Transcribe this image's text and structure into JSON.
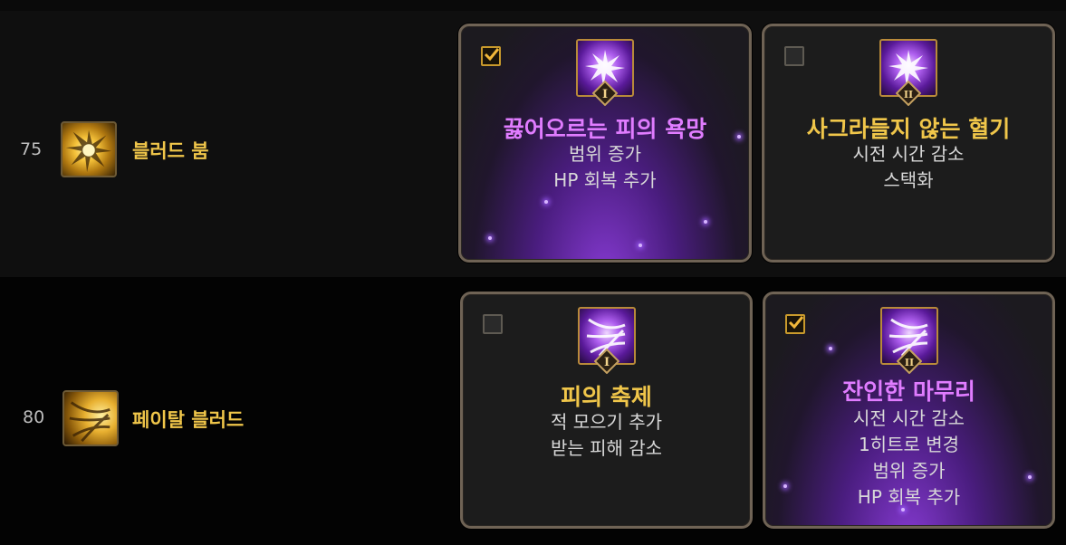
{
  "rows": [
    {
      "level": "75",
      "skill_name": "블러드 붐",
      "skill_icon": "blood-boom-icon",
      "options": [
        {
          "selected": true,
          "rune_numeral": "I",
          "title": "끓어오르는 피의 욕망",
          "effects": [
            "범위 증가",
            "HP 회복 추가"
          ]
        },
        {
          "selected": false,
          "rune_numeral": "II",
          "title": "사그라들지 않는 혈기",
          "effects": [
            "시전 시간 감소",
            "스택화"
          ]
        }
      ]
    },
    {
      "level": "80",
      "skill_name": "페이탈 블러드",
      "skill_icon": "fatal-blood-icon",
      "options": [
        {
          "selected": false,
          "rune_numeral": "I",
          "title": "피의 축제",
          "effects": [
            "적 모으기 추가",
            "받는 피해 감소"
          ]
        },
        {
          "selected": true,
          "rune_numeral": "II",
          "title": "잔인한 마무리",
          "effects": [
            "시전 시간 감소",
            "1히트로 변경",
            "범위 증가",
            "HP 회복 추가"
          ]
        }
      ]
    }
  ],
  "colors": {
    "title_gold": "#f0c64a",
    "title_selected_purple": "#e07cff",
    "card_border": "#6f6355",
    "check_gold": "#c99a2c"
  }
}
